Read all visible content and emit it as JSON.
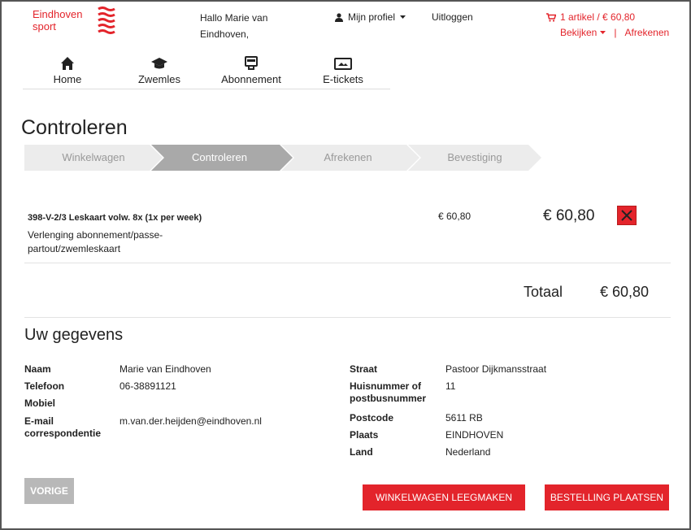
{
  "header": {
    "logo_line1": "Eindhoven",
    "logo_line2": "sport",
    "greeting": "Hallo Marie van Eindhoven,",
    "profile_label": "Mijn profiel",
    "logout_label": "Uitloggen",
    "cart_summary": "1 artikel / € 60,80",
    "cart_view": "Bekijken",
    "cart_separator": "|",
    "cart_checkout": "Afrekenen"
  },
  "nav": [
    {
      "label": "Home",
      "icon": "home-icon"
    },
    {
      "label": "Zwemles",
      "icon": "graduation-cap-icon"
    },
    {
      "label": "Abonnement",
      "icon": "card-icon"
    },
    {
      "label": "E-tickets",
      "icon": "ticket-icon"
    }
  ],
  "page_title": "Controleren",
  "steps": [
    {
      "label": "Winkelwagen",
      "active": false
    },
    {
      "label": "Controleren",
      "active": true
    },
    {
      "label": "Afrekenen",
      "active": false
    },
    {
      "label": "Bevestiging",
      "active": false
    }
  ],
  "line_item": {
    "title": "398-V-2/3 Leskaart volw. 8x (1x per week)",
    "description": "Verlenging abonnement/passe-partout/zwemleskaart",
    "unit_price": "€ 60,80",
    "total": "€ 60,80"
  },
  "totals": {
    "label": "Totaal",
    "value": "€ 60,80"
  },
  "details": {
    "title": "Uw gegevens",
    "left": [
      {
        "label": "Naam",
        "value": "Marie van Eindhoven"
      },
      {
        "label": "Telefoon",
        "value": "06-38891121"
      },
      {
        "label": "Mobiel",
        "value": ""
      },
      {
        "label": "E-mail correspondentie",
        "value": "m.van.der.heijden@eindhoven.nl"
      }
    ],
    "right": [
      {
        "label": "Straat",
        "value": "Pastoor Dijkmansstraat"
      },
      {
        "label": "Huisnummer of postbusnummer",
        "value": "11"
      },
      {
        "label": "Postcode",
        "value": "5611 RB"
      },
      {
        "label": "Plaats",
        "value": "EINDHOVEN"
      },
      {
        "label": "Land",
        "value": "Nederland"
      }
    ]
  },
  "buttons": {
    "previous": "VORIGE",
    "empty_cart": "WINKELWAGEN LEEGMAKEN",
    "place_order": "BESTELLING PLAATSEN"
  },
  "colors": {
    "accent": "#e3242b",
    "step_active": "#a9a9a9",
    "step_inactive": "#ececec"
  }
}
